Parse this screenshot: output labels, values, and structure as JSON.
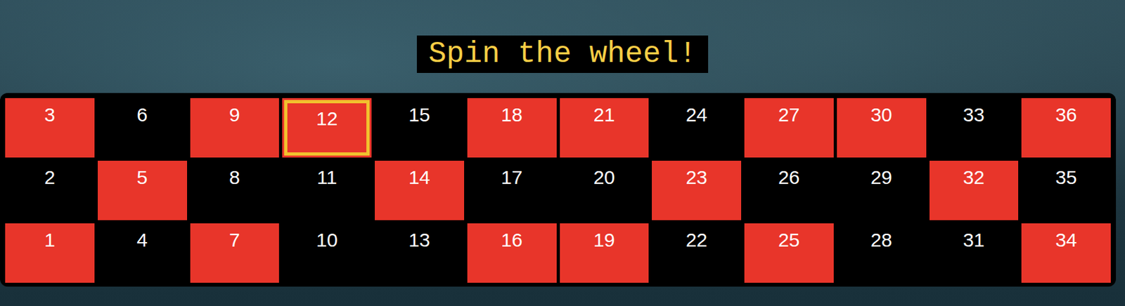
{
  "title": "Spin the wheel!",
  "rows": [
    [
      {
        "number": "3",
        "color": "#e8352a",
        "selected": false
      },
      {
        "number": "6",
        "color": "#000000",
        "selected": false
      },
      {
        "number": "9",
        "color": "#e8352a",
        "selected": false
      },
      {
        "number": "12",
        "color": "#e8352a",
        "selected": true
      },
      {
        "number": "15",
        "color": "#000000",
        "selected": false
      },
      {
        "number": "18",
        "color": "#e8352a",
        "selected": false
      },
      {
        "number": "21",
        "color": "#e8352a",
        "selected": false
      },
      {
        "number": "24",
        "color": "#000000",
        "selected": false
      },
      {
        "number": "27",
        "color": "#e8352a",
        "selected": false
      },
      {
        "number": "30",
        "color": "#e8352a",
        "selected": false
      },
      {
        "number": "33",
        "color": "#000000",
        "selected": false
      },
      {
        "number": "36",
        "color": "#e8352a",
        "selected": false
      }
    ],
    [
      {
        "number": "2",
        "color": "#000000",
        "selected": false
      },
      {
        "number": "5",
        "color": "#e8352a",
        "selected": false
      },
      {
        "number": "8",
        "color": "#000000",
        "selected": false
      },
      {
        "number": "11",
        "color": "#000000",
        "selected": false
      },
      {
        "number": "14",
        "color": "#e8352a",
        "selected": false
      },
      {
        "number": "17",
        "color": "#000000",
        "selected": false
      },
      {
        "number": "20",
        "color": "#000000",
        "selected": false
      },
      {
        "number": "23",
        "color": "#e8352a",
        "selected": false
      },
      {
        "number": "26",
        "color": "#000000",
        "selected": false
      },
      {
        "number": "29",
        "color": "#000000",
        "selected": false
      },
      {
        "number": "32",
        "color": "#e8352a",
        "selected": false
      },
      {
        "number": "35",
        "color": "#000000",
        "selected": false
      }
    ],
    [
      {
        "number": "1",
        "color": "#e8352a",
        "selected": false
      },
      {
        "number": "4",
        "color": "#000000",
        "selected": false
      },
      {
        "number": "7",
        "color": "#e8352a",
        "selected": false
      },
      {
        "number": "10",
        "color": "#000000",
        "selected": false
      },
      {
        "number": "13",
        "color": "#000000",
        "selected": false
      },
      {
        "number": "16",
        "color": "#e8352a",
        "selected": false
      },
      {
        "number": "19",
        "color": "#e8352a",
        "selected": false
      },
      {
        "number": "22",
        "color": "#000000",
        "selected": false
      },
      {
        "number": "25",
        "color": "#e8352a",
        "selected": false
      },
      {
        "number": "28",
        "color": "#000000",
        "selected": false
      },
      {
        "number": "31",
        "color": "#000000",
        "selected": false
      },
      {
        "number": "34",
        "color": "#e8352a",
        "selected": false
      }
    ]
  ]
}
